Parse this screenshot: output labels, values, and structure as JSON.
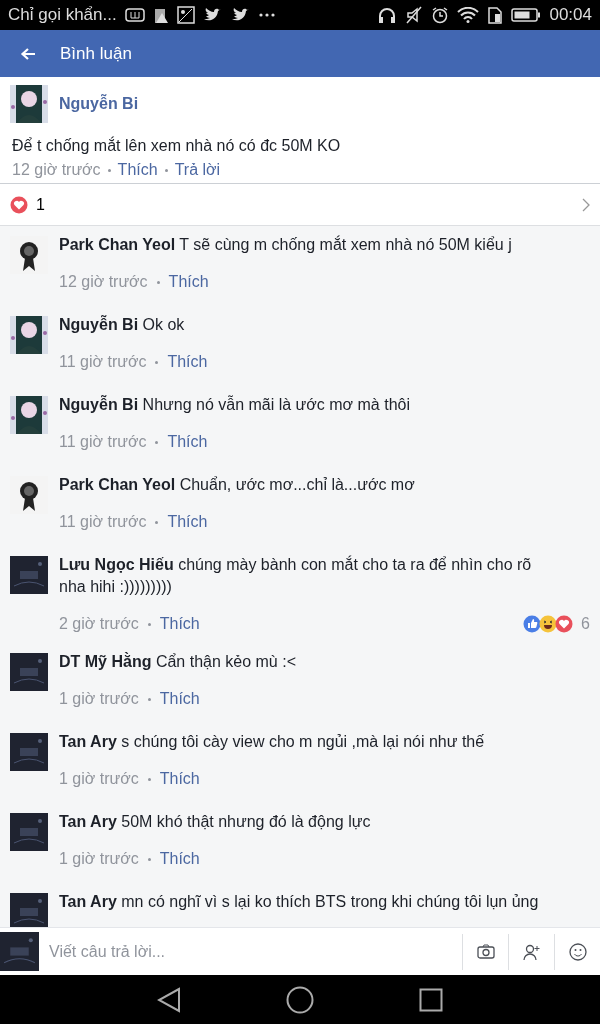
{
  "status_bar": {
    "notification": "Chỉ gọi khẩn...",
    "time": "00:04"
  },
  "header": {
    "title": "Bình luận"
  },
  "comment": {
    "author": "Nguyễn Bi",
    "text": "Để t chống mắt lên xem nhà nó có đc 50M KO",
    "time": "12 giờ trước",
    "like": "Thích",
    "reply": "Trả lời"
  },
  "reaction_summary": {
    "icons": [
      {
        "kind": "love"
      }
    ],
    "count": "1"
  },
  "replies": [
    {
      "author": "Park Chan Yeol",
      "text": "T sẽ cùng m chống mắt xem nhà nó 50M kiểu j",
      "time": "12 giờ trước",
      "like": "Thích"
    },
    {
      "author": "Nguyễn Bi",
      "text": "Ok ok",
      "time": "11 giờ trước",
      "like": "Thích"
    },
    {
      "author": "Nguyễn Bi",
      "text": "Nhưng nó vẫn mãi là ước mơ mà thôi",
      "time": "11 giờ trước",
      "like": "Thích"
    },
    {
      "author": "Park Chan Yeol",
      "text": "Chuẩn, ước mơ...chỉ là...ước mơ",
      "time": "11 giờ trước",
      "like": "Thích"
    },
    {
      "author": "Lưu Ngọc Hiếu",
      "text": "chúng mày bành con mắt cho ta ra để nhìn cho rõ nha hihi :)))))))))",
      "time": "2 giờ trước",
      "like": "Thích",
      "reactions": {
        "icons": [
          {
            "kind": "like"
          },
          {
            "kind": "haha"
          },
          {
            "kind": "love"
          }
        ],
        "count": "6"
      }
    },
    {
      "author": "DT Mỹ Hằng",
      "text": "Cẩn thận kẻo mù :<",
      "time": "1 giờ trước",
      "like": "Thích"
    },
    {
      "author": "Tan Ary",
      "text": "s chúng tôi cày view cho m ngủi ,mà lại nói như thế",
      "time": "1 giờ trước",
      "like": "Thích"
    },
    {
      "author": "Tan Ary",
      "text": "50M khó thật nhưng đó là động lực",
      "time": "1 giờ trước",
      "like": "Thích"
    },
    {
      "author": "Tan Ary",
      "text": "mn có nghĩ vì s lại ko thích BTS trong khi chúng tôi lụn ủng"
    }
  ],
  "composer": {
    "placeholder": "Viết câu trả lời..."
  }
}
